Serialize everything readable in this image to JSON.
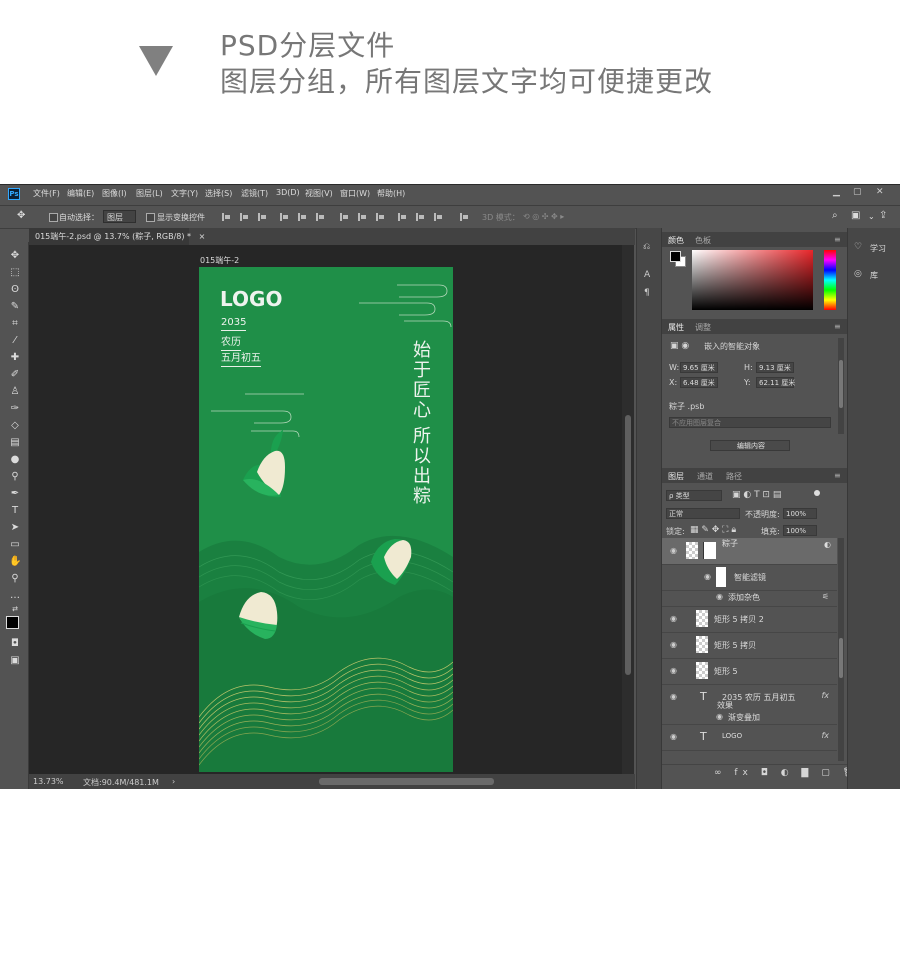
{
  "header": {
    "line1": "PSD分层文件",
    "line2": "图层分组，所有图层文字均可便捷更改"
  },
  "app": {
    "logo_text": "Ps",
    "menu": [
      "文件(F)",
      "编辑(E)",
      "图像(I)",
      "图层(L)",
      "文字(Y)",
      "选择(S)",
      "滤镜(T)",
      "3D(D)",
      "视图(V)",
      "窗口(W)",
      "帮助(H)"
    ],
    "window_buttons": [
      "▁",
      "▢",
      "✕"
    ]
  },
  "options_bar": {
    "auto_select": "自动选择：",
    "layer_select": "图层",
    "show_transform": "显示变换控件",
    "mode_3d": "3D 模式："
  },
  "document": {
    "tab_title": "015端午-2.psd @ 13.7% (粽子, RGB/8) *",
    "tab_close": "×",
    "artboard_label": "015端午-2",
    "zoom": "13.73%",
    "doc_size": "文档:90.4M/481.1M",
    "status_arrow": "›"
  },
  "artboard": {
    "logo": "LOGO",
    "year": "2035",
    "lunar": "农历",
    "date": "五月初五",
    "vertical_line1": "始于匠心",
    "vertical_line2": "所以出粽",
    "bg_color": "#1f8f48",
    "wave_color": "#b9c46a"
  },
  "color_panel": {
    "tabs": [
      "颜色",
      "色板"
    ]
  },
  "properties_panel": {
    "tabs": [
      "属性",
      "调整"
    ],
    "object_type": "嵌入的智能对象",
    "w_label": "W:",
    "w_value": "9.65 厘米",
    "h_label": "H:",
    "h_value": "9.13 厘米",
    "x_label": "X:",
    "x_value": "6.48 厘米",
    "y_label": "Y:",
    "y_value": "62.11 厘米",
    "file_name": "粽子 .psb",
    "comp_placeholder": "不应用图层复合",
    "edit_button": "编辑内容"
  },
  "layers_panel": {
    "tabs": [
      "图层",
      "通道",
      "路径"
    ],
    "kind_filter": "ρ 类型",
    "blend_mode": "正常",
    "opacity_label": "不透明度:",
    "opacity_value": "100%",
    "lock_label": "锁定:",
    "fill_label": "填充:",
    "fill_value": "100%",
    "layers": [
      {
        "name": "粽子",
        "type": "smart",
        "selected": true
      },
      {
        "name": "智能滤镜",
        "type": "filter"
      },
      {
        "name": "添加杂色",
        "type": "sub"
      },
      {
        "name": "矩形 5 拷贝 2",
        "type": "shape"
      },
      {
        "name": "矩形 5 拷贝",
        "type": "shape"
      },
      {
        "name": "矩形 5",
        "type": "shape"
      },
      {
        "name": "2035 农历  五月初五",
        "type": "text",
        "fx": "fx"
      },
      {
        "name": "效果",
        "type": "effect"
      },
      {
        "name": "渐变叠加",
        "type": "sub"
      },
      {
        "name": "LOGO",
        "type": "text",
        "fx": "fx"
      }
    ]
  },
  "right_dock": {
    "learn": "学习",
    "library": "库"
  }
}
